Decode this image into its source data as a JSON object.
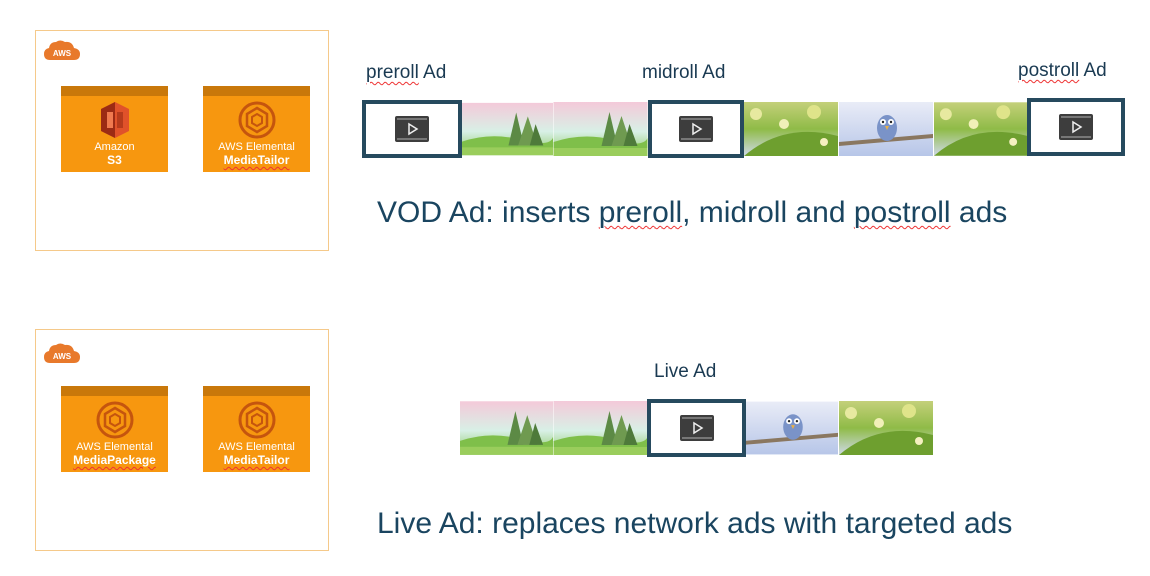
{
  "vod": {
    "aws_badge": "AWS",
    "services": [
      {
        "line1": "Amazon",
        "line2": "S3"
      },
      {
        "line1": "AWS Elemental",
        "line2": "MediaTailor"
      }
    ],
    "labels": {
      "preroll": "preroll",
      "preroll_ad": "Ad",
      "midroll": "midroll Ad",
      "postroll": "postroll",
      "postroll_ad": "Ad"
    },
    "caption_parts": [
      "VOD Ad: inserts ",
      "preroll",
      ", midroll and ",
      "postroll",
      " ads"
    ]
  },
  "live": {
    "aws_badge": "AWS",
    "services": [
      {
        "line1": "AWS Elemental",
        "line2": "MediaPackage"
      },
      {
        "line1": "AWS Elemental",
        "line2": "MediaTailor"
      }
    ],
    "label": "Live Ad",
    "caption": "Live Ad: replaces network ads with targeted ads"
  },
  "colors": {
    "aws_orange": "#f7970f",
    "ad_border": "#264a5e",
    "caption_text": "#1a4560"
  }
}
